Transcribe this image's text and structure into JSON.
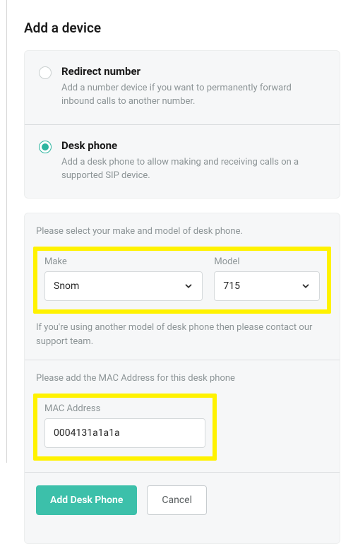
{
  "page": {
    "title": "Add a device"
  },
  "options": {
    "redirect": {
      "title": "Redirect number",
      "desc": "Add a number device if you want to permanently forward inbound calls to another number.",
      "selected": false
    },
    "deskphone": {
      "title": "Desk phone",
      "desc": "Add a desk phone to allow making and receiving calls on a supported SIP device.",
      "selected": true
    }
  },
  "makeModel": {
    "lead": "Please select your make and model of desk phone.",
    "makeLabel": "Make",
    "makeValue": "Snom",
    "modelLabel": "Model",
    "modelValue": "715",
    "hint": "If you're using another model of desk phone then please contact our support team."
  },
  "mac": {
    "lead": "Please add the MAC Address for this desk phone",
    "label": "MAC Address",
    "value": "0004131a1a1a"
  },
  "actions": {
    "primary": "Add Desk Phone",
    "secondary": "Cancel"
  }
}
